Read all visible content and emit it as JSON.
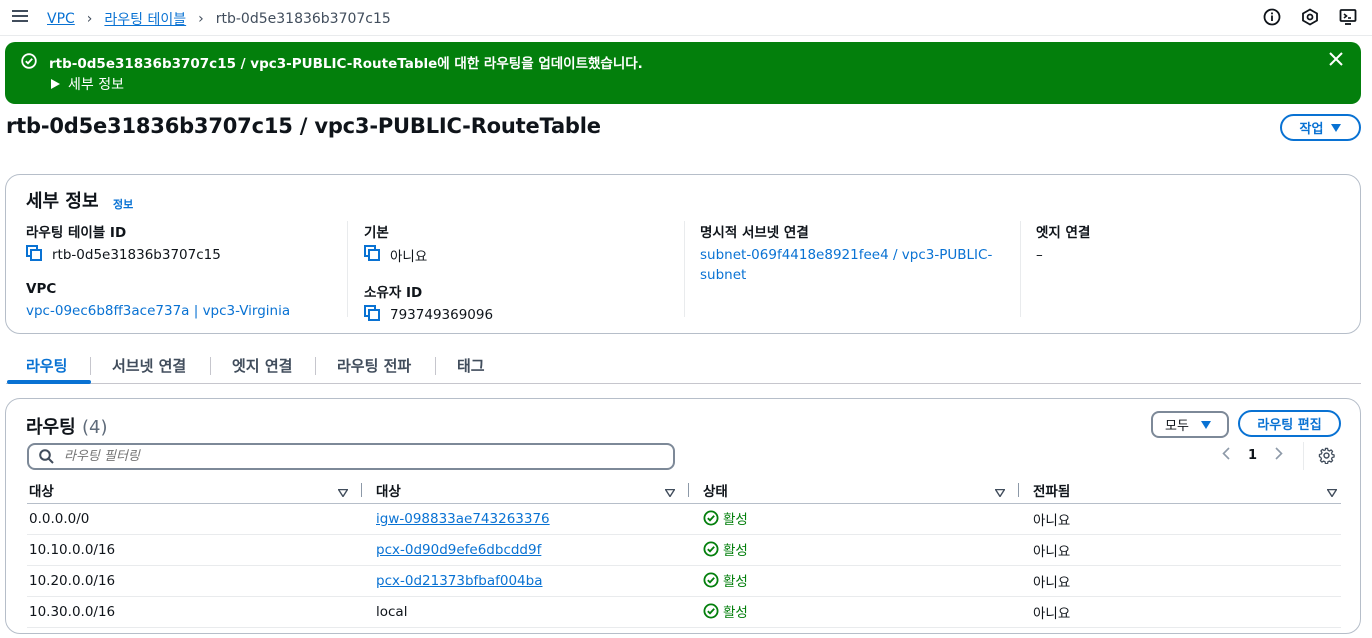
{
  "breadcrumb": {
    "root": "VPC",
    "parent": "라우팅 테이블",
    "current": "rtb-0d5e31836b3707c15"
  },
  "flash": {
    "message": "rtb-0d5e31836b3707c15 / vpc3-PUBLIC-RouteTable에 대한 라우팅을 업데이트했습니다.",
    "details_label": "세부 정보"
  },
  "page": {
    "title": "rtb-0d5e31836b3707c15 / vpc3-PUBLIC-RouteTable",
    "action_label": "작업"
  },
  "details": {
    "heading": "세부 정보",
    "info_link": "정보",
    "route_table_id_label": "라우팅 테이블 ID",
    "route_table_id": "rtb-0d5e31836b3707c15",
    "vpc_label": "VPC",
    "vpc": "vpc-09ec6b8ff3ace737a | vpc3-Virginia",
    "main_label": "기본",
    "main": "아니요",
    "owner_label": "소유자 ID",
    "owner": "793749369096",
    "subnet_label": "명시적 서브넷 연결",
    "subnet_line1": "subnet-069f4418e8921fee4 / vpc3-PUBLIC-",
    "subnet_line2": "subnet",
    "edge_label": "엣지 연결",
    "edge": "–"
  },
  "tabs": [
    "라우팅",
    "서브넷 연결",
    "엣지 연결",
    "라우팅 전파",
    "태그"
  ],
  "routes": {
    "heading": "라우팅",
    "count": "(4)",
    "filter_label": "모두",
    "edit_label": "라우팅 편집",
    "search_placeholder": "라우팅 필터링",
    "page": "1",
    "columns": [
      "대상",
      "대상",
      "상태",
      "전파됨"
    ],
    "rows": [
      {
        "destination": "0.0.0.0/0",
        "target": "igw-098833ae743263376",
        "target_link": true,
        "status": "활성",
        "propagated": "아니요"
      },
      {
        "destination": "10.10.0.0/16",
        "target": "pcx-0d90d9efe6dbcdd9f",
        "target_link": true,
        "status": "활성",
        "propagated": "아니요"
      },
      {
        "destination": "10.20.0.0/16",
        "target": "pcx-0d21373bfbaf004ba",
        "target_link": true,
        "status": "활성",
        "propagated": "아니요"
      },
      {
        "destination": "10.30.0.0/16",
        "target": "local",
        "target_link": false,
        "status": "활성",
        "propagated": "아니요"
      }
    ]
  },
  "colors": {
    "link": "#0972d3",
    "success": "#037f0c",
    "text": "#0f141a"
  }
}
